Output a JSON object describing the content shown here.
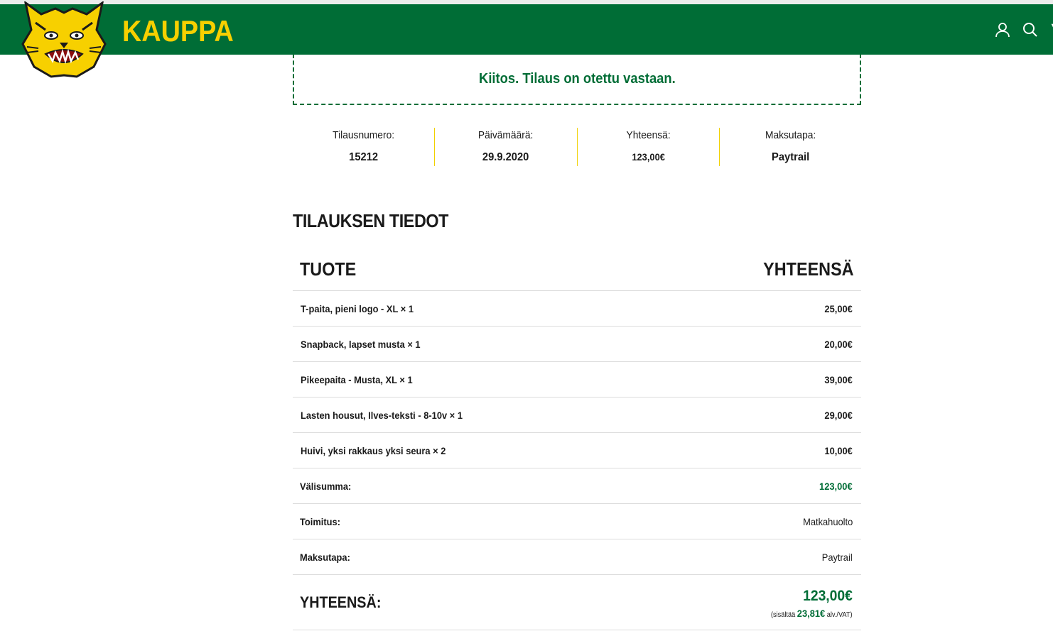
{
  "header": {
    "brand": "KAUPPA",
    "logo_icon": "lynx-head-logo",
    "icons": [
      "user-icon",
      "search-icon"
    ],
    "colors": {
      "bar": "#006d36",
      "brand": "#f7d000"
    }
  },
  "notice": {
    "text": "Kiitos. Tilaus on otettu vastaan."
  },
  "summary": [
    {
      "label": "Tilausnumero:",
      "value": "15212"
    },
    {
      "label": "Päivämäärä:",
      "value": "29.9.2020"
    },
    {
      "label": "Yhteensä:",
      "value": "123,00€"
    },
    {
      "label": "Maksutapa:",
      "value": "Paytrail"
    }
  ],
  "details": {
    "title": "TILAUKSEN TIEDOT",
    "col_product": "TUOTE",
    "col_total": "YHTEENSÄ",
    "items": [
      {
        "name": "T-paita, pieni logo - XL",
        "qty": "× 1",
        "price": "25,00€"
      },
      {
        "name": "Snapback, lapset musta",
        "qty": "× 1",
        "price": "20,00€"
      },
      {
        "name": "Pikeepaita - Musta, XL",
        "qty": "× 1",
        "price": "39,00€"
      },
      {
        "name": "Lasten housut, Ilves-teksti - 8-10v",
        "qty": "× 1",
        "price": "29,00€"
      },
      {
        "name": "Huivi, yksi rakkaus yksi seura",
        "qty": "× 2",
        "price": "10,00€"
      }
    ],
    "subtotal_label": "Välisumma:",
    "subtotal_value": "123,00€",
    "shipping_label": "Toimitus:",
    "shipping_value": "Matkahuolto",
    "payment_label": "Maksutapa:",
    "payment_value": "Paytrail",
    "total_label": "YHTEENSÄ:",
    "total_value": "123,00€",
    "tax_prefix": "(sisältää",
    "tax_amount": "23,81€",
    "tax_suffix": "alv./VAT)"
  }
}
